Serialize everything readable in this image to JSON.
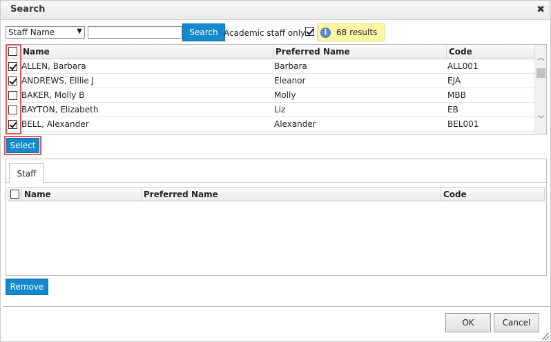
{
  "dialog": {
    "title": "Search",
    "close_glyph": "✖"
  },
  "search": {
    "field_select": "Staff Name",
    "query_value": "",
    "search_label": "Search",
    "academic_label": "Academic staff only?",
    "academic_checked": true,
    "results_text": "68 results",
    "info_glyph": "i"
  },
  "results_grid": {
    "columns": [
      "Name",
      "Preferred Name",
      "Code"
    ],
    "rows": [
      {
        "checked": true,
        "name": "ALLEN, Barbara",
        "preferred": "Barbara",
        "code": "ALL001"
      },
      {
        "checked": true,
        "name": "ANDREWS, Elllie J",
        "preferred": "Eleanor",
        "code": "EJA"
      },
      {
        "checked": false,
        "name": "BAKER, Molly B",
        "preferred": "Molly",
        "code": "MBB"
      },
      {
        "checked": false,
        "name": "BAYTON, Elizabeth",
        "preferred": "Liz",
        "code": "EB"
      },
      {
        "checked": true,
        "name": "BELL, Alexander",
        "preferred": "Alexander",
        "code": "BEL001"
      }
    ]
  },
  "actions": {
    "select_label": "Select",
    "remove_label": "Remove",
    "ok_label": "OK",
    "cancel_label": "Cancel"
  },
  "selected_panel": {
    "tab_label": "Staff",
    "columns": [
      "Name",
      "Preferred Name",
      "Code"
    ],
    "rows": []
  },
  "colors": {
    "accent_blue": "#1589cc",
    "highlight_red": "#e05555",
    "results_yellow": "#fcf6a5"
  }
}
